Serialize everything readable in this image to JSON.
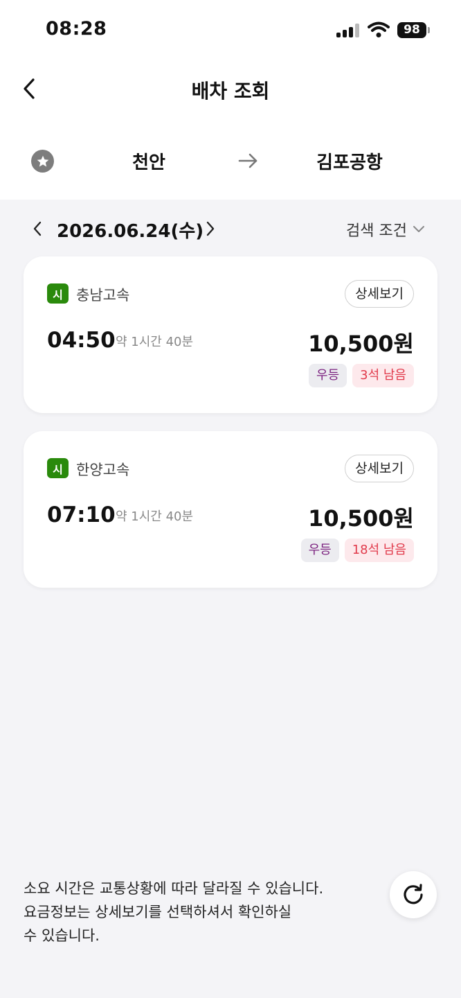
{
  "status_bar": {
    "time": "08:28",
    "battery": "98"
  },
  "header": {
    "title": "배차 조회"
  },
  "route": {
    "origin": "천안",
    "destination": "김포공항"
  },
  "date_bar": {
    "date": "2026.06.24(수)",
    "filter_label": "검색 조건"
  },
  "buses": [
    {
      "type_badge": "시",
      "company": "충남고속",
      "departure": "04:50",
      "duration": "약 1시간 40분",
      "price": "10,500원",
      "grade": "우등",
      "seats": "3석 남음",
      "detail_label": "상세보기"
    },
    {
      "type_badge": "시",
      "company": "한양고속",
      "departure": "07:10",
      "duration": "약 1시간 40분",
      "price": "10,500원",
      "grade": "우등",
      "seats": "18석 남음",
      "detail_label": "상세보기"
    }
  ],
  "footer": {
    "notice_lines": [
      "소요 시간은 교통상황에 따라 달라질 수 있습니다.",
      "요금정보는 상세보기를 선택하셔서 확인하실",
      "수 있습니다."
    ]
  },
  "colors": {
    "badge_green": "#2a8a0c",
    "grade_text": "#7a1f7e",
    "seats_text": "#e13a4b",
    "background": "#f4f4f7"
  },
  "icons": [
    "back-chevron-icon",
    "star-icon",
    "arrow-right-icon",
    "chevron-left-icon",
    "chevron-right-icon",
    "chevron-down-icon",
    "refresh-icon",
    "signal-icon",
    "wifi-icon",
    "battery-icon"
  ]
}
